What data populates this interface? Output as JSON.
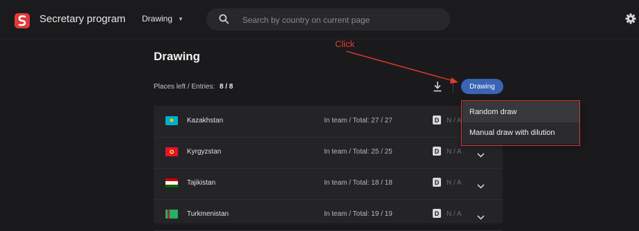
{
  "app": {
    "title": "Secretary program",
    "logo_icon": "app-logo-icon"
  },
  "nav": {
    "dropdown_label": "Drawing"
  },
  "search": {
    "placeholder": "Search by country on current page",
    "value": ""
  },
  "page": {
    "title": "Drawing",
    "counts_label": "Places left / Entries:",
    "counts_value": "8 / 8",
    "draw_button_label": "Drawing"
  },
  "annotation": {
    "label": "Click",
    "color": "#e33b2e"
  },
  "draw_menu": {
    "items": [
      {
        "label": "Random draw"
      },
      {
        "label": "Manual draw with dilution"
      }
    ]
  },
  "team_label": "In team / Total:",
  "rows": [
    {
      "country": "Kazakhstan",
      "team_total": "In team / Total: 27 / 27",
      "badge": "D",
      "status": "N / A",
      "flag": "kazakhstan-flag-icon"
    },
    {
      "country": "Kyrgyzstan",
      "team_total": "In team / Total: 25 / 25",
      "badge": "D",
      "status": "N / A",
      "flag": "kyrgyzstan-flag-icon"
    },
    {
      "country": "Tajikistan",
      "team_total": "In team / Total: 18 / 18",
      "badge": "D",
      "status": "N / A",
      "flag": "tajikistan-flag-icon"
    },
    {
      "country": "Turkmenistan",
      "team_total": "In team / Total: 19 / 19",
      "badge": "D",
      "status": "N / A",
      "flag": "turkmenistan-flag-icon"
    }
  ],
  "colors": {
    "accent": "#3a64b4",
    "background": "#1a1a1c",
    "panel": "#242427"
  }
}
